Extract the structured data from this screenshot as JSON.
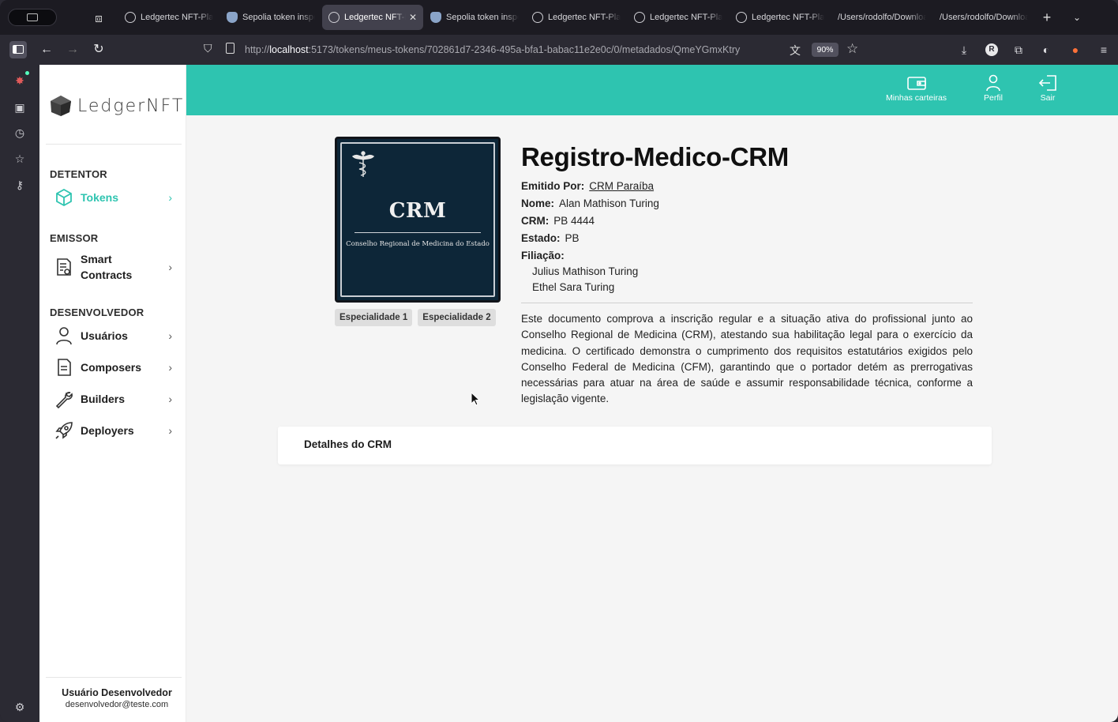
{
  "browser": {
    "tabs": [
      {
        "title": "Ledgertec NFT-Plataforma",
        "icon": "ledger-favicon",
        "active": false
      },
      {
        "title": "Sepolia token inspector",
        "icon": "sepolia-favicon",
        "active": false
      },
      {
        "title": "Ledgertec NFT-Plataforma",
        "icon": "ledger-favicon",
        "active": true
      },
      {
        "title": "Sepolia token inspector",
        "icon": "sepolia-favicon",
        "active": false
      },
      {
        "title": "Ledgertec NFT-Plataforma",
        "icon": "ledger-favicon",
        "active": false
      },
      {
        "title": "Ledgertec NFT-Plataforma",
        "icon": "ledger-favicon",
        "active": false
      },
      {
        "title": "Ledgertec NFT-Plataforma",
        "icon": "ledger-favicon",
        "active": false
      },
      {
        "title": "/Users/rodolfo/Downloads",
        "icon": "none",
        "active": false
      },
      {
        "title": "/Users/rodolfo/Downloads",
        "icon": "none",
        "active": false
      }
    ],
    "url_host": "localhost",
    "url_prefix": "http://",
    "url_rest": ":5173/tokens/meus-tokens/702861d7-2346-495a-bfa1-babac11e2e0c/0/metadados/QmeYGmxKtry",
    "zoom": "90%",
    "profile_initial": "R"
  },
  "sidebar": {
    "logo_text": "LedgerNFT",
    "sections": [
      {
        "heading": "DETENTOR"
      },
      {
        "heading": "EMISSOR"
      },
      {
        "heading": "DESENVOLVEDOR"
      }
    ],
    "items": [
      {
        "label": "Tokens",
        "icon": "cube-icon",
        "active": true
      },
      {
        "label": "Smart Contracts",
        "icon": "contract-doc-icon"
      },
      {
        "label": "Usuários",
        "icon": "user-icon"
      },
      {
        "label": "Composers",
        "icon": "document-icon"
      },
      {
        "label": "Builders",
        "icon": "wrench-icon"
      },
      {
        "label": "Deployers",
        "icon": "rocket-icon"
      }
    ],
    "user_name": "Usuário Desenvolvedor",
    "user_email": "desenvolvedor@teste.com"
  },
  "topbar": {
    "wallets_label": "Minhas carteiras",
    "profile_label": "Perfil",
    "logout_label": "Sair",
    "accent": "#2ec4b0"
  },
  "token": {
    "image": {
      "title": "CRM",
      "subtitle": "Conselho Regional de Medicina do Estado"
    },
    "tags": [
      "Especialidade 1",
      "Especialidade 2"
    ],
    "name": "Registro-Medico-CRM",
    "issued_by_label": "Emitido Por:",
    "issued_by": "CRM Paraíba",
    "name_label": "Nome:",
    "name_value": "Alan Mathison Turing",
    "crm_label": "CRM:",
    "crm_value": "PB 4444",
    "state_label": "Estado:",
    "state_value": "PB",
    "filiation_label": "Filiação:",
    "filiation": [
      "Julius Mathison Turing",
      "Ethel Sara Turing"
    ],
    "description": "Este documento comprova a inscrição regular e a situação ativa do profissional junto ao Conselho Regional de Medicina (CRM), atestando sua habilitação legal para o exercício da medicina. O certificado demonstra o cumprimento dos requisitos estatutários exigidos pelo Conselho Federal de Medicina (CFM), garantindo que o portador detém as prerrogativas necessárias para atuar na área de saúde e assumir responsabilidade técnica, conforme a legislação vigente.",
    "details_label": "Detalhes do CRM"
  }
}
